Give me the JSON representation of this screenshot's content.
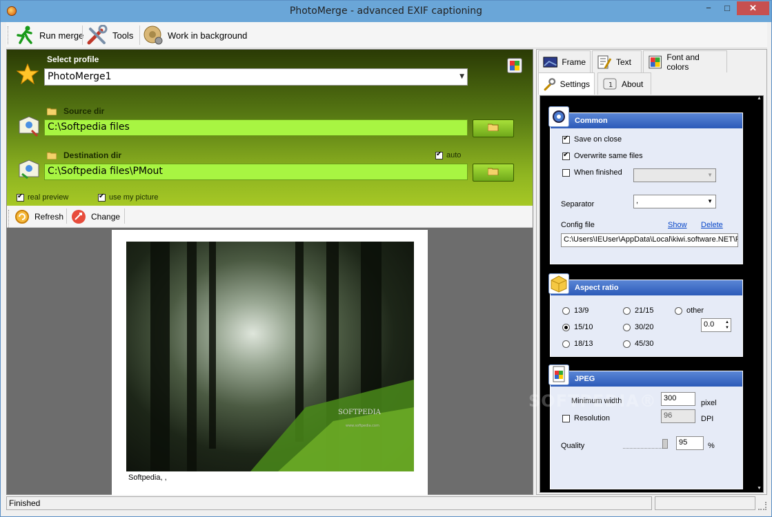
{
  "window": {
    "title": "PhotoMerge - advanced EXIF captioning",
    "min": "−",
    "max": "□",
    "close": "✕"
  },
  "toolbar": {
    "run": "Run merge",
    "tools": "Tools",
    "background": "Work in background"
  },
  "profile": {
    "label": "Select profile",
    "value": "PhotoMerge1"
  },
  "source": {
    "label": "Source dir",
    "value": "C:\\Softpedia files"
  },
  "dest": {
    "label": "Destination dir",
    "value": "C:\\Softpedia files\\PMout",
    "auto_label": "auto",
    "auto": true
  },
  "options": {
    "real_preview": "real preview",
    "use_my_picture": "use my picture"
  },
  "preview_toolbar": {
    "refresh": "Refresh",
    "change": "Change"
  },
  "preview": {
    "caption": "Softpedia, ,",
    "watermark": "SOFTPEDIA",
    "watermark_url": "www.softpedia.com"
  },
  "tabs": {
    "frame": "Frame",
    "text": "Text",
    "font": "Font and colors",
    "settings": "Settings",
    "about": "About"
  },
  "common": {
    "title": "Common",
    "save_on_close": "Save on close",
    "overwrite": "Overwrite same files",
    "when_finished": "When finished",
    "separator_label": "Separator",
    "separator_value": ",",
    "config_label": "Config file",
    "show": "Show",
    "delete": "Delete",
    "config_path": "C:\\Users\\IEUser\\AppData\\Local\\kiwi.software.NET\\P"
  },
  "aspect": {
    "title": "Aspect ratio",
    "r1": "13/9",
    "r2": "21/15",
    "r3": "other",
    "r4": "15/10",
    "r5": "30/20",
    "r6": "18/13",
    "r7": "45/30",
    "other_value": "0.0",
    "selected": "15/10"
  },
  "jpeg": {
    "title": "JPEG",
    "min_width_label": "Minimum width",
    "min_width": "300",
    "pixel": "pixel",
    "resolution_label": "Resolution",
    "resolution": "96",
    "dpi": "DPI",
    "quality_label": "Quality",
    "quality": "95",
    "percent": "%"
  },
  "status": {
    "text": "Finished"
  },
  "watermark": "SOFTPEDIA®",
  "colors": {
    "titlebar": "#6aa6d8",
    "close": "#c75050",
    "green_input": "#a8f542",
    "panel_head": "#2c5ab8"
  }
}
